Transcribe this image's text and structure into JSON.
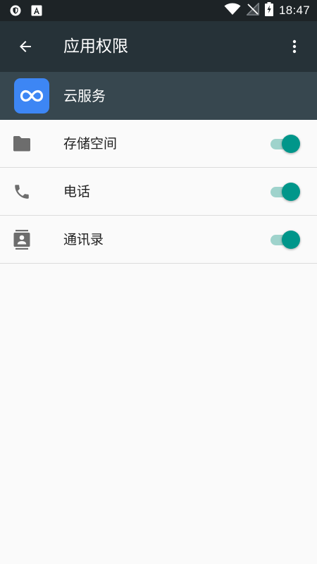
{
  "status_bar": {
    "time": "18:47",
    "left_icons": [
      "shield-notification-icon",
      "letter-a-notification-icon"
    ],
    "right_icons": [
      "wifi-icon",
      "no-sim-icon",
      "battery-charging-icon"
    ]
  },
  "app_bar": {
    "title": "应用权限",
    "back_icon": "arrow-back-icon",
    "more_icon": "more-vert-icon"
  },
  "app_header": {
    "name": "云服务",
    "icon": "infinity-icon",
    "icon_bg": "#3d86f4"
  },
  "permissions": [
    {
      "label": "存储空间",
      "icon": "folder-icon",
      "enabled": true
    },
    {
      "label": "电话",
      "icon": "phone-icon",
      "enabled": true
    },
    {
      "label": "通讯录",
      "icon": "contacts-icon",
      "enabled": true
    }
  ],
  "colors": {
    "status_bar": "#1d2326",
    "app_bar": "#263238",
    "app_header": "#37474f",
    "switch_thumb": "#00968a",
    "switch_track": "#9fd3cc"
  }
}
